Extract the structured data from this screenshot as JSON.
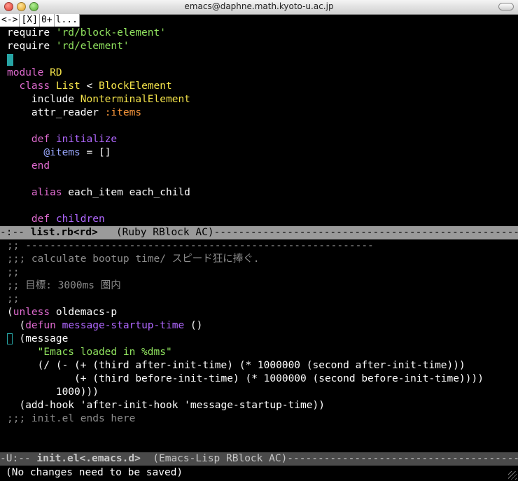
{
  "window": {
    "title": "emacs@daphne.math.kyoto-u.ac.jp"
  },
  "tabline": {
    "items": [
      "<->",
      "[X]",
      "0+",
      "l..."
    ]
  },
  "top_buffer": {
    "lines": [
      [
        [
          "require ",
          "txt"
        ],
        [
          "'rd/block-element'",
          "str"
        ]
      ],
      [
        [
          "require ",
          "txt"
        ],
        [
          "'rd/element'",
          "str"
        ]
      ],
      [],
      [
        [
          "module ",
          "kw"
        ],
        [
          "RD",
          "cls"
        ]
      ],
      [
        [
          "  class ",
          "kw"
        ],
        [
          "List",
          "cls"
        ],
        [
          " < ",
          "txt"
        ],
        [
          "BlockElement",
          "cls"
        ]
      ],
      [
        [
          "    include ",
          "txt"
        ],
        [
          "NonterminalElement",
          "cls"
        ]
      ],
      [
        [
          "    attr_reader ",
          "txt"
        ],
        [
          ":items",
          "sym"
        ]
      ],
      [],
      [
        [
          "    def ",
          "kw"
        ],
        [
          "initialize",
          "fn"
        ]
      ],
      [
        [
          "      ",
          "txt"
        ],
        [
          "@items",
          "ivar"
        ],
        [
          " = []",
          "txt"
        ]
      ],
      [
        [
          "    end",
          "kw"
        ]
      ],
      [],
      [
        [
          "    ",
          "txt"
        ],
        [
          "alias",
          "kw"
        ],
        [
          " each_item each_child",
          "txt"
        ]
      ],
      [],
      [
        [
          "    def ",
          "kw"
        ],
        [
          "children",
          "fn"
        ]
      ]
    ],
    "modeline": {
      "prefix": "-:-- ",
      "buffer": "list.rb<rd>",
      "rest": "   (Ruby RBlock AC)--------------------------------------------------------"
    }
  },
  "bottom_buffer": {
    "lines": [
      [
        [
          ";; ---------------------------------------------------------",
          "cm"
        ]
      ],
      [
        [
          ";;; calculate bootup time/ スピード狂に捧ぐ.",
          "cm"
        ]
      ],
      [
        [
          ";;",
          "cm"
        ]
      ],
      [
        [
          ";; 目標: 3000ms 圏内",
          "cm"
        ]
      ],
      [
        [
          ";;",
          "cm"
        ]
      ],
      [
        [
          "(",
          "txt"
        ],
        [
          "unless",
          "kw"
        ],
        [
          " oldemacs-p",
          "txt"
        ]
      ],
      [
        [
          "  (",
          "txt"
        ],
        [
          "defun",
          "kw"
        ],
        [
          " ",
          "txt"
        ],
        [
          "message-startup-time",
          "fn"
        ],
        [
          " ()",
          "txt"
        ]
      ],
      [
        [
          "  (message",
          "txt"
        ]
      ],
      [
        [
          "     ",
          "txt"
        ],
        [
          "\"Emacs loaded in %dms\"",
          "str"
        ]
      ],
      [
        [
          "     (/ (- (+ (third after-init-time) (* 1000000 (second after-init-time)))",
          "txt"
        ]
      ],
      [
        [
          "           (+ (third before-init-time) (* 1000000 (second before-init-time))))",
          "txt"
        ]
      ],
      [
        [
          "        1000)))",
          "txt"
        ]
      ],
      [
        [
          "  (add-hook 'after-init-hook 'message-startup-time))",
          "txt"
        ]
      ],
      [
        [
          ";;; init.el ends here",
          "cm"
        ]
      ]
    ],
    "modeline": {
      "prefix": "-U:-- ",
      "buffer": "init.el<.emacs.d>",
      "rest": "  (Emacs-Lisp RBlock AC)-------------------------------------------------"
    }
  },
  "minibuffer": {
    "text": "(No changes need to be saved)"
  },
  "colors": {
    "cursor": "#27a5a5",
    "string": "#8fe15e",
    "class": "#f4e34a",
    "keyword": "#e06bd0",
    "function": "#b067ff"
  }
}
